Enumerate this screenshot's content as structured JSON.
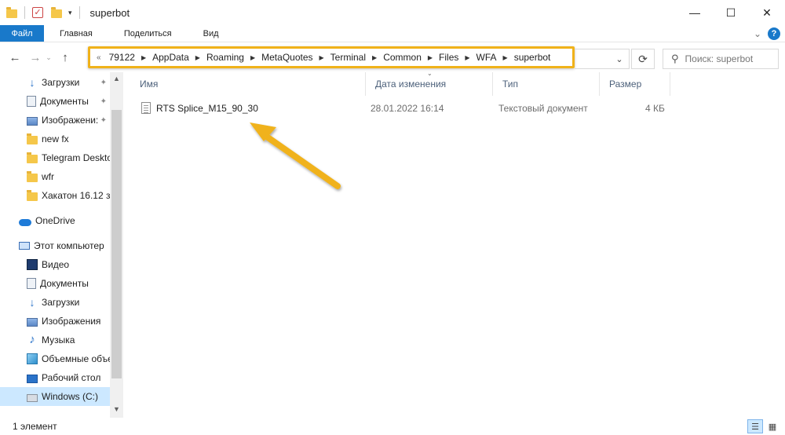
{
  "window": {
    "title": "superbot",
    "controls": {
      "minimize": "—",
      "maximize": "☐",
      "close": "✕"
    }
  },
  "ribbon": {
    "tabs": [
      "Файл",
      "Главная",
      "Поделиться",
      "Вид"
    ]
  },
  "address": {
    "lead": "«",
    "crumbs": [
      "79122",
      "AppData",
      "Roaming",
      "MetaQuotes",
      "Terminal",
      "Common",
      "Files",
      "WFA",
      "superbot"
    ],
    "highlight_color": "#f0b21a"
  },
  "search": {
    "placeholder": "Поиск: superbot"
  },
  "sidebar": {
    "quick_access": [
      {
        "label": "Загрузки",
        "icon": "download-arrow-icon",
        "pinned": true
      },
      {
        "label": "Документы",
        "icon": "documents-icon",
        "pinned": true
      },
      {
        "label": "Изображени:",
        "icon": "pictures-icon",
        "pinned": true
      },
      {
        "label": "new fx",
        "icon": "folder-icon",
        "pinned": false
      },
      {
        "label": "Telegram Deskto",
        "icon": "folder-icon",
        "pinned": false
      },
      {
        "label": "wfr",
        "icon": "folder-icon",
        "pinned": false
      },
      {
        "label": "Хакатон 16.12 зе",
        "icon": "folder-icon",
        "pinned": false
      }
    ],
    "onedrive": "OneDrive",
    "this_pc": "Этот компьютер",
    "pc_items": [
      {
        "label": "Видео",
        "icon": "video-icon"
      },
      {
        "label": "Документы",
        "icon": "documents-icon"
      },
      {
        "label": "Загрузки",
        "icon": "download-arrow-icon"
      },
      {
        "label": "Изображения",
        "icon": "pictures-icon"
      },
      {
        "label": "Музыка",
        "icon": "music-icon"
      },
      {
        "label": "Объемные объе",
        "icon": "3d-objects-icon"
      },
      {
        "label": "Рабочий стол",
        "icon": "desktop-icon"
      },
      {
        "label": "Windows (C:)",
        "icon": "drive-icon",
        "selected": true
      }
    ]
  },
  "columns": [
    "Имя",
    "Дата изменения",
    "Тип",
    "Размер"
  ],
  "files": [
    {
      "name": "RTS Splice_M15_90_30",
      "modified": "28.01.2022 16:14",
      "type": "Текстовый документ",
      "size": "4 КБ"
    }
  ],
  "status": {
    "count": "1 элемент"
  },
  "annotation_color": "#f0b21a"
}
